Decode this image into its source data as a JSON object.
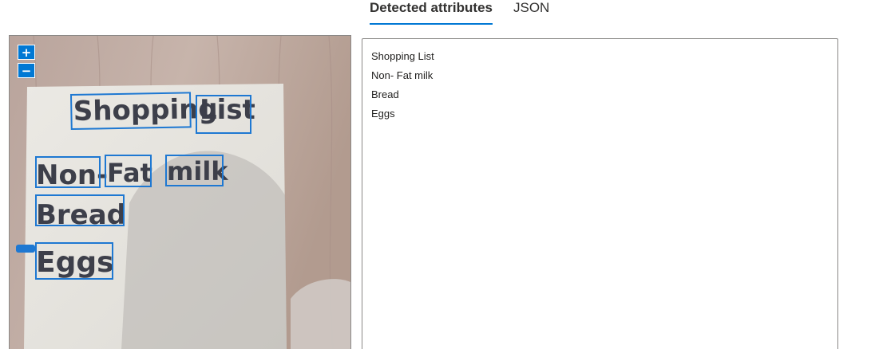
{
  "tabs": [
    {
      "label": "Detected attributes",
      "active": true
    },
    {
      "label": "JSON",
      "active": false
    }
  ],
  "zoom": {
    "in_label": "+",
    "out_label": "−"
  },
  "detected_lines": [
    "Shopping List",
    "Non- Fat milk",
    "Bread",
    "Eggs"
  ],
  "colors": {
    "accent": "#0078d4",
    "box": "#1e78d2"
  }
}
